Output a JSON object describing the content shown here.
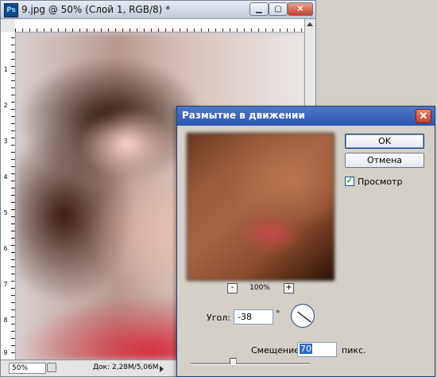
{
  "document": {
    "title": "9.jpg @ 50% (Слой 1, RGB/8) *",
    "app_icon": "Ps",
    "ruler_labels": [
      "1",
      "2",
      "3",
      "4",
      "5",
      "6",
      "7",
      "8",
      "9"
    ],
    "status": {
      "zoom": "50%",
      "info": "Док: 2,28M/5,06M"
    }
  },
  "dialog": {
    "title": "Размытие в движении",
    "ok_label": "OK",
    "cancel_label": "Отмена",
    "preview_label": "Просмотр",
    "preview_checked": true,
    "zoom_minus": "-",
    "zoom_plus": "+",
    "zoom_level": "100%",
    "angle_label": "Угол:",
    "angle_value": "-38",
    "angle_unit": "°",
    "distance_label": "Смещение:",
    "distance_value": "70",
    "distance_unit": "пикс.",
    "distance_slider_fraction": 0.35
  },
  "icons": {
    "close": "close-icon",
    "minimize": "minimize-icon",
    "maximize": "maximize-icon",
    "check": "checkmark-icon"
  },
  "colors": {
    "dialog_title_bar": "#2a56b1",
    "selection": "#316ac5",
    "close_button": "#c2402a"
  }
}
